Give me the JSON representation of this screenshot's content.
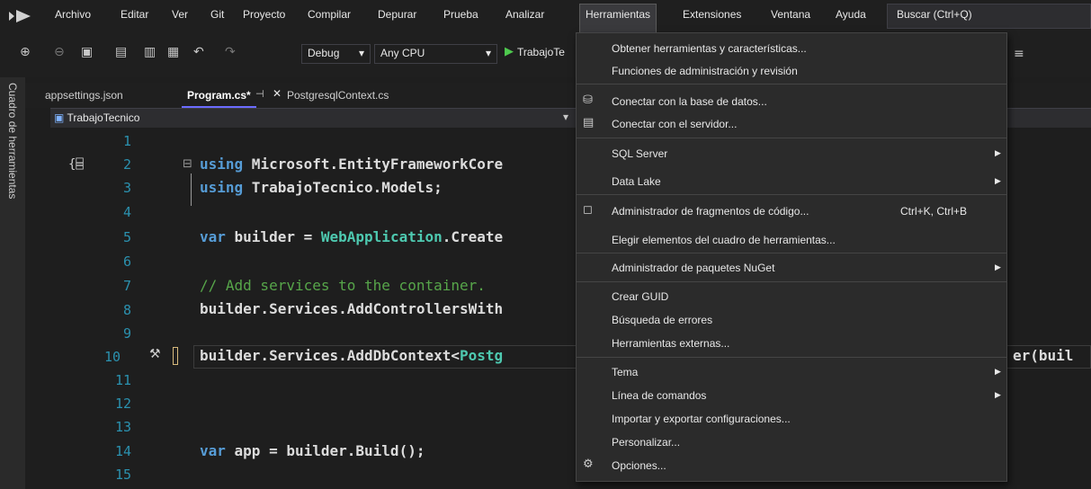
{
  "menubar": {
    "items": [
      "Archivo",
      "Editar",
      "Ver",
      "Git",
      "Proyecto",
      "Compilar",
      "Depurar",
      "Prueba",
      "Analizar",
      "Herramientas",
      "Extensiones",
      "Ventana",
      "Ayuda"
    ],
    "search": "Buscar (Ctrl+Q)"
  },
  "toolbar": {
    "config": "Debug",
    "platform": "Any CPU",
    "run_target": "TrabajoTe"
  },
  "side": {
    "label": "Cuadro de herramientas"
  },
  "tabs": [
    "appsettings.json",
    "Program.cs*",
    "PostgresqlContext.cs"
  ],
  "nav": {
    "project": "TrabajoTecnico"
  },
  "editor": {
    "line_numbers": [
      "1",
      "2",
      "3",
      "4",
      "5",
      "6",
      "7",
      "8",
      "9",
      "10",
      "11",
      "12",
      "13",
      "14",
      "15"
    ],
    "lines": {
      "l2_kw": "using",
      "l2_rest": " Microsoft.EntityFrameworkCore",
      "l3_kw": "using",
      "l3_rest": " TrabajoTecnico.Models;",
      "l5_kw": "var",
      "l5_mid": " builder = ",
      "l5_ty": "WebApplication",
      "l5_rest": ".Create",
      "l7": "// Add services to the container.",
      "l8": "builder.Services.AddControllersWith",
      "l10_a": "builder.Services.AddDbContext<",
      "l10_ty": "Postg",
      "l10_tail": "er(buil",
      "l14_kw": "var",
      "l14_rest": " app = builder.Build();"
    }
  },
  "tools_menu": {
    "items": [
      {
        "label": "Obtener herramientas y características..."
      },
      {
        "label": "Funciones de administración y revisión"
      },
      {
        "label": "Conectar con la base de datos...",
        "icon": "database-icon"
      },
      {
        "label": "Conectar con el servidor...",
        "icon": "server-icon"
      },
      {
        "label": "SQL Server",
        "submenu": true
      },
      {
        "label": "Data Lake",
        "submenu": true
      },
      {
        "label": "Administrador de fragmentos de código...",
        "shortcut": "Ctrl+K, Ctrl+B",
        "icon": "snippet-icon"
      },
      {
        "label": "Elegir elementos del cuadro de herramientas..."
      },
      {
        "label": "Administrador de paquetes NuGet",
        "submenu": true
      },
      {
        "label": "Crear GUID"
      },
      {
        "label": "Búsqueda de errores"
      },
      {
        "label": "Herramientas externas..."
      },
      {
        "label": "Tema",
        "submenu": true
      },
      {
        "label": "Línea de comandos",
        "submenu": true
      },
      {
        "label": "Importar y exportar configuraciones..."
      },
      {
        "label": "Personalizar..."
      },
      {
        "label": "Opciones...",
        "icon": "gear-icon"
      }
    ]
  }
}
